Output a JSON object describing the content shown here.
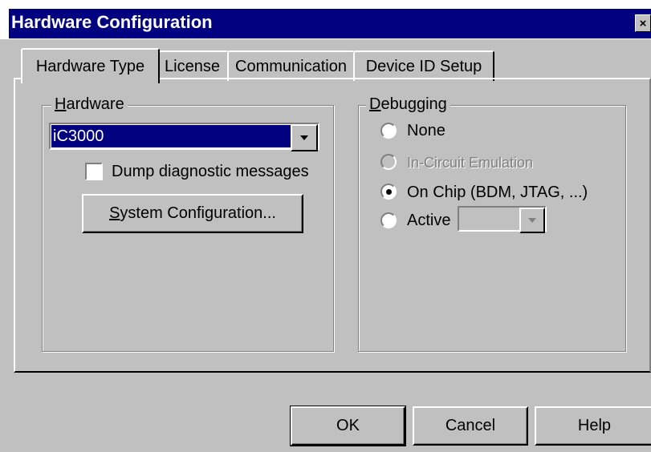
{
  "window": {
    "title": "Hardware Configuration",
    "close_glyph": "×"
  },
  "tabs": [
    {
      "label": "Hardware Type",
      "active": true
    },
    {
      "label": "License",
      "active": false
    },
    {
      "label": "Communication",
      "active": false
    },
    {
      "label": "Device ID Setup",
      "active": false
    }
  ],
  "hardware_group": {
    "legend_mnemonic": "H",
    "legend_rest": "ardware",
    "combo": {
      "selected": "iC3000",
      "icon": "chevron-down-icon"
    },
    "checkbox": {
      "label": "Dump diagnostic messages",
      "checked": false
    },
    "system_config": {
      "mnemonic": "S",
      "rest": "ystem Configuration..."
    }
  },
  "debugging_group": {
    "legend_mnemonic": "D",
    "legend_rest": "ebugging",
    "options": [
      {
        "label": "None",
        "selected": false,
        "enabled": true
      },
      {
        "label": "In-Circuit Emulation",
        "selected": false,
        "enabled": false
      },
      {
        "label": "On Chip (BDM, JTAG, ...)",
        "selected": true,
        "enabled": true
      },
      {
        "label": "Active",
        "selected": false,
        "enabled": true
      }
    ],
    "active_combo": {
      "value": "",
      "enabled": false
    }
  },
  "buttons": {
    "ok": "OK",
    "cancel": "Cancel",
    "help": "Help"
  },
  "colors": {
    "titlebar": "#000080",
    "face": "#c0c0c0",
    "selection": "#000080"
  }
}
